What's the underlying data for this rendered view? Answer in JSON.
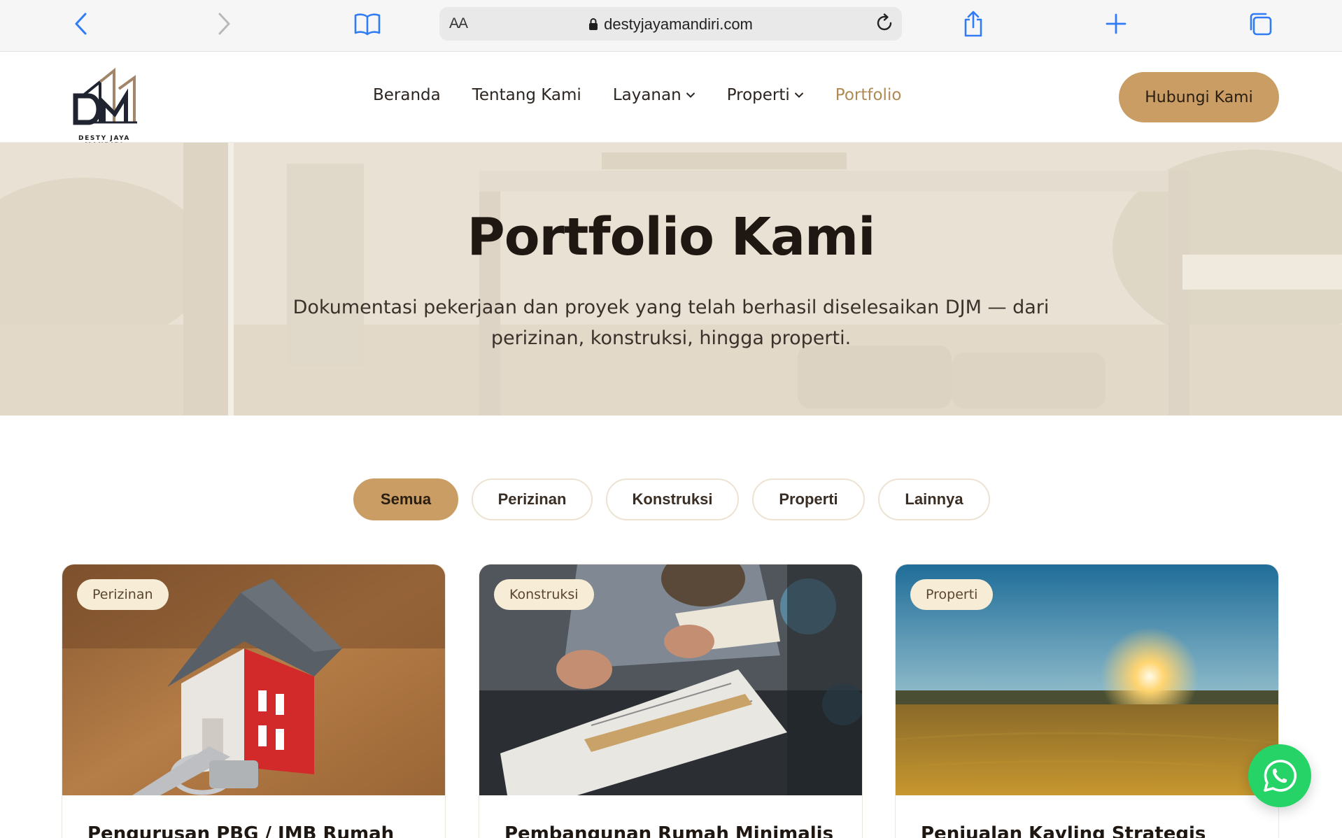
{
  "browser": {
    "aa_label": "AA",
    "url": "destyjayamandiri.com"
  },
  "header": {
    "brand": "DESTY JAYA MANDIRI",
    "nav": {
      "home": "Beranda",
      "about": "Tentang Kami",
      "services": "Layanan",
      "property": "Properti",
      "portfolio": "Portfolio"
    },
    "cta": "Hubungi Kami"
  },
  "hero": {
    "title": "Portfolio Kami",
    "subtitle": "Dokumentasi pekerjaan dan proyek yang telah berhasil diselesaikan DJM — dari perizinan, konstruksi, hingga properti."
  },
  "filters": {
    "all": "Semua",
    "permits": "Perizinan",
    "construction": "Konstruksi",
    "property": "Properti",
    "others": "Lainnya"
  },
  "cards": [
    {
      "tag": "Perizinan",
      "title": "Pengurusan PBG / IMB Rumah"
    },
    {
      "tag": "Konstruksi",
      "title": "Pembangunan Rumah Minimalis"
    },
    {
      "tag": "Properti",
      "title": "Penjualan Kavling Strategis"
    }
  ],
  "icons": {
    "back": "chevron-left-icon",
    "forward": "chevron-right-icon",
    "bookmarks": "book-icon",
    "lock": "lock-icon",
    "reload": "reload-icon",
    "share": "share-icon",
    "new_tab": "plus-icon",
    "tabs": "tabs-icon",
    "whatsapp": "whatsapp-icon"
  },
  "colors": {
    "accent": "#c99d63",
    "browser_blue": "#2f7cf6",
    "tag_bg": "#f7edd6",
    "whatsapp": "#25d366"
  }
}
